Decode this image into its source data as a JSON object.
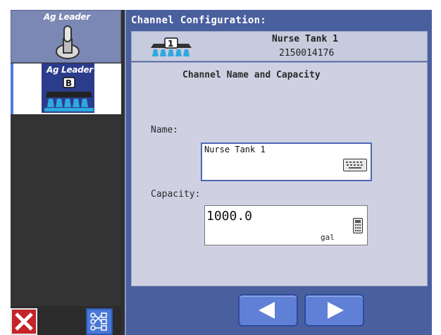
{
  "sidebar": {
    "tiles": [
      {
        "brand": "Ag Leader"
      },
      {
        "brand": "Ag Leader",
        "badge": "B"
      }
    ]
  },
  "panel": {
    "title": "Channel Configuration:",
    "channel": {
      "name": "Nurse Tank 1",
      "id": "2150014176",
      "icon_badge": "1"
    },
    "section_title": "Channel Name and Capacity",
    "name_label": "Name:",
    "name_value": "Nurse Tank 1",
    "capacity_label": "Capacity:",
    "capacity_value": "1000.0",
    "capacity_unit": "gal"
  },
  "colors": {
    "panel_bg": "#4a5f9e",
    "content_bg": "#cfd1e3",
    "cancel": "#c4242a",
    "accent": "#4a78d6"
  }
}
